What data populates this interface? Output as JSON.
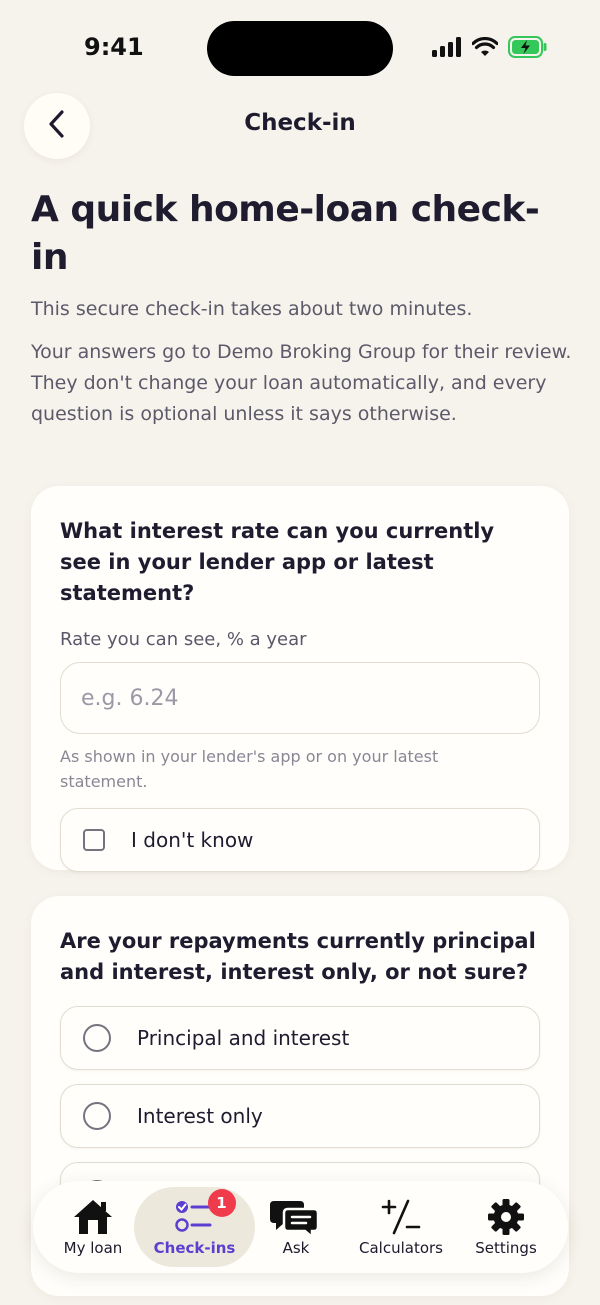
{
  "status_bar": {
    "time": "9:41",
    "icons": [
      "signal-icon",
      "wifi-icon",
      "battery-charging-icon"
    ],
    "battery_color": "#34c759"
  },
  "header": {
    "title": "Check-in",
    "back_icon": "chevron-left-icon"
  },
  "intro": {
    "title": "A quick home-loan check-in",
    "subtitle": "This secure check-in takes about two minutes.",
    "body": "Your answers go to Demo Broking Group for their review. They don't change your loan automatically, and every question is optional unless it says otherwise."
  },
  "questions": [
    {
      "question": "What interest rate can you currently see in your lender app or latest statement?",
      "field_label": "Rate you can see, % a year",
      "placeholder": "e.g. 6.24",
      "value": "",
      "help_text": "As shown in your lender's app or on your latest statement.",
      "checkbox_label": "I don't know",
      "checked": false
    },
    {
      "question": "Are your repayments currently principal and interest, interest only, or not sure?",
      "options": [
        {
          "label": "Principal and interest",
          "selected": false
        },
        {
          "label": "Interest only",
          "selected": false
        },
        {
          "label": "",
          "selected": false
        }
      ]
    }
  ],
  "tab_bar": {
    "active": "Check-ins",
    "accent_color": "#5b3fd0",
    "badge_color": "#f03b4d",
    "tabs": [
      {
        "label": "My loan",
        "icon": "home-icon"
      },
      {
        "label": "Check-ins",
        "icon": "checklist-icon",
        "badge": "1"
      },
      {
        "label": "Ask",
        "icon": "chat-bubbles-icon"
      },
      {
        "label": "Calculators",
        "icon": "calculator-icon"
      },
      {
        "label": "Settings",
        "icon": "gear-icon"
      }
    ]
  }
}
